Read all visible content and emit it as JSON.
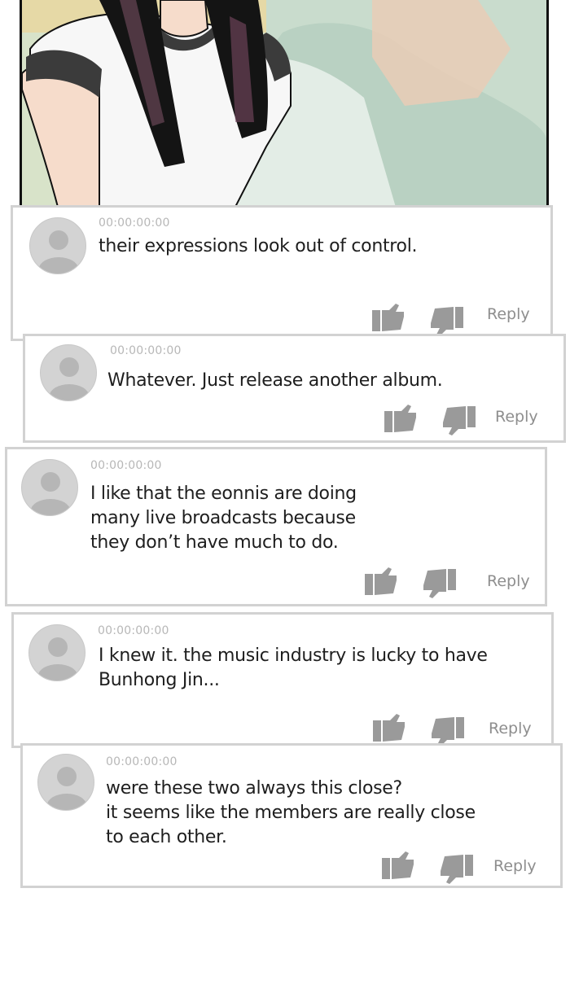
{
  "comments": [
    {
      "timestamp": "00:00:00:00",
      "text": "their expressions look out of control.",
      "reply_label": "Reply"
    },
    {
      "timestamp": "00:00:00:00",
      "text": "Whatever. Just release another album.",
      "reply_label": "Reply"
    },
    {
      "timestamp": "00:00:00:00",
      "text": "I like that the eonnis are doing\nmany live broadcasts because\nthey don’t have much to do.",
      "reply_label": "Reply"
    },
    {
      "timestamp": "00:00:00:00",
      "text": "I knew it. the music industry is lucky to have\nBunhong Jin...",
      "reply_label": "Reply"
    },
    {
      "timestamp": "00:00:00:00",
      "text": "were these two always this close?\nit seems like the members are really close\nto each other.",
      "reply_label": "Reply"
    }
  ],
  "icons": {
    "avatar": "default-user-avatar-icon",
    "like": "thumbs-up-icon",
    "dislike": "thumbs-down-icon"
  },
  "colors": {
    "card_border": "#d2d2d2",
    "timestamp": "#b7b7b7",
    "icon": "#9a9a9a",
    "avatar_bg": "#d3d3d3",
    "text": "#1e1e1e"
  }
}
